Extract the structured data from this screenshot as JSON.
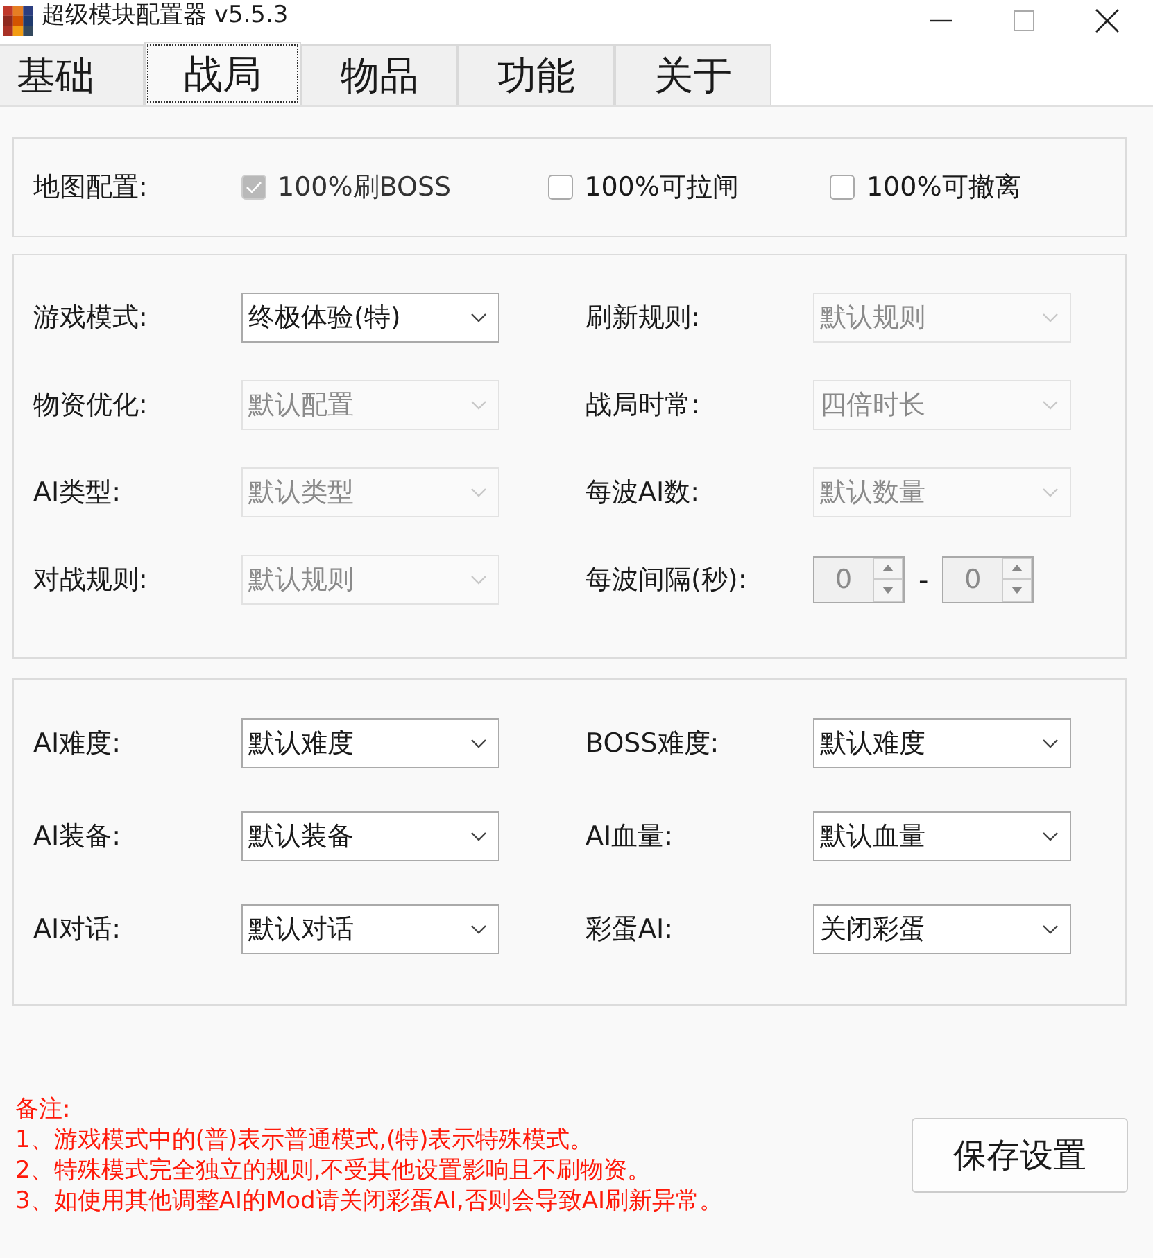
{
  "window": {
    "title": "超级模块配置器 v5.5.3"
  },
  "tabs": [
    {
      "label": "基础",
      "selected": false
    },
    {
      "label": "战局",
      "selected": true
    },
    {
      "label": "物品",
      "selected": false
    },
    {
      "label": "功能",
      "selected": false
    },
    {
      "label": "关于",
      "selected": false
    }
  ],
  "map_config": {
    "label": "地图配置:",
    "options": [
      {
        "label": "100%刷BOSS",
        "checked": true,
        "disabled": true
      },
      {
        "label": "100%可拉闸",
        "checked": false,
        "disabled": false
      },
      {
        "label": "100%可撤离",
        "checked": false,
        "disabled": false
      }
    ]
  },
  "battle_settings": [
    {
      "label": "游戏模式:",
      "kind": "select",
      "value": "终极体验(特)",
      "disabled": false
    },
    {
      "label": "刷新规则:",
      "kind": "select",
      "value": "默认规则",
      "disabled": true
    },
    {
      "label": "物资优化:",
      "kind": "select",
      "value": "默认配置",
      "disabled": true
    },
    {
      "label": "战局时常:",
      "kind": "select",
      "value": "四倍时长",
      "disabled": true
    },
    {
      "label": "AI类型:",
      "kind": "select",
      "value": "默认类型",
      "disabled": true
    },
    {
      "label": "每波AI数:",
      "kind": "select",
      "value": "默认数量",
      "disabled": true
    },
    {
      "label": "对战规则:",
      "kind": "select",
      "value": "默认规则",
      "disabled": true
    },
    {
      "label": "每波间隔(秒):",
      "kind": "range",
      "from": "0",
      "separator": "-",
      "to": "0",
      "disabled": true
    }
  ],
  "ai_settings": [
    {
      "label": "AI难度:",
      "kind": "select",
      "value": "默认难度",
      "disabled": false
    },
    {
      "label": "BOSS难度:",
      "kind": "select",
      "value": "默认难度",
      "disabled": false
    },
    {
      "label": "AI装备:",
      "kind": "select",
      "value": "默认装备",
      "disabled": false
    },
    {
      "label": "AI血量:",
      "kind": "select",
      "value": "默认血量",
      "disabled": false
    },
    {
      "label": "AI对话:",
      "kind": "select",
      "value": "默认对话",
      "disabled": false
    },
    {
      "label": "彩蛋AI:",
      "kind": "select",
      "value": "关闭彩蛋",
      "disabled": false
    }
  ],
  "notes": [
    "备注:",
    "1、游戏模式中的(普)表示普通模式,(特)表示特殊模式。",
    "2、特殊模式完全独立的规则,不受其他设置影响且不刷物资。",
    "3、如使用其他调整AI的Mod请关闭彩蛋AI,否则会导致AI刷新异常。"
  ],
  "save_button": "保存设置"
}
